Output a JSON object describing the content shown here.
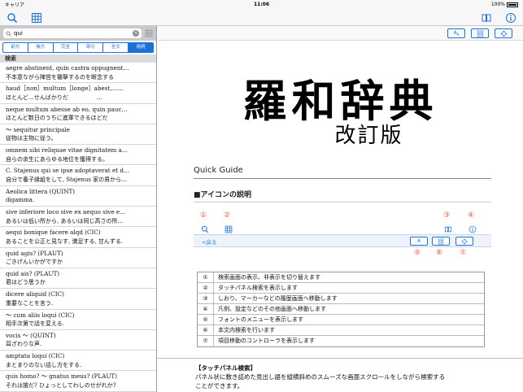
{
  "status": {
    "carrier": "キャリア",
    "time": "11:06",
    "battery": "100%"
  },
  "navbar": {
    "icons": [
      "search-icon",
      "grid-icon",
      "book-icon",
      "info-icon"
    ]
  },
  "search": {
    "query": "qui",
    "clear": "×"
  },
  "segments": [
    "前方",
    "後方",
    "完全",
    "部分",
    "全文",
    "用例"
  ],
  "section_header": "検索",
  "entries": [
    {
      "latin": "aegre abstinent, quin castra oppugnent…",
      "ja": "不本意ながら陣営を襲撃するのを断念する"
    },
    {
      "latin": "haud［non］multum［longe］abest,……",
      "ja": "ほとんど…せんばかりだ　　　　　…"
    },
    {
      "latin": "neque multum abesse ab eo, quin pauc…",
      "ja": "ほとんど数日のうちに進軍できるほどだ"
    },
    {
      "latin": "～ sequitur principale",
      "ja": "従物は主物に従う。"
    },
    {
      "latin": "omnem sibi reliquae vitae dignitatem a…",
      "ja": "自らの余生にあらゆる地位を獲得する。"
    },
    {
      "latin": "C. Stajenus qui se ipse adoptaverat et d…",
      "ja": "自分で養子縁組をして, Stajenus 家の男から…"
    },
    {
      "latin": "Aeolica littera (QUINT)",
      "ja": "digamma."
    },
    {
      "latin": "sive inferiore loco sive ex aequo sive e…",
      "ja": "あるいは低い所から, あるいは同じ高さの所…"
    },
    {
      "latin": "aequi bonique facere alqd (CIC)",
      "ja": "あることを公正と見なす, 満足する, 甘んずる."
    },
    {
      "latin": "quid agis? (PLAUT)",
      "ja": "ごきげんいかがですか"
    },
    {
      "latin": "quid ais? (PLAUT)",
      "ja": "君はどう思うか"
    },
    {
      "latin": "dicere aliquid (CIC)",
      "ja": "重要なことを言う."
    },
    {
      "latin": "～ cum aliis loqui (CIC)",
      "ja": "相手次第で話を変える."
    },
    {
      "latin": "vocis ～ (QUINT)",
      "ja": "耳ざわりな声."
    },
    {
      "latin": "amptata loqui (CIC)",
      "ja": "まとまりのない話し方をする."
    },
    {
      "latin": "quis homo? ～ gnatus meus? (PLAUT)",
      "ja": "それは誰だ? ひょっとしてわしのせがれか?"
    }
  ],
  "toolbar2": {
    "font_label": "A",
    "font_sub": "A"
  },
  "cover": {
    "title": "羅和辞典",
    "edition": "改訂版"
  },
  "guide": {
    "quick_guide": "Quick Guide",
    "icons_heading": "■アイコンの説明",
    "back_label": "<戻る",
    "numbers": [
      "①",
      "②",
      "③",
      "④",
      "⑤",
      "⑥",
      "⑦"
    ],
    "rows": [
      {
        "n": "①",
        "text": "検索画面の表示、非表示を切り替えます"
      },
      {
        "n": "②",
        "text": "タッチパネル検索を表示します"
      },
      {
        "n": "③",
        "text": "しおり、マーカーなどの履歴画面へ移動します"
      },
      {
        "n": "④",
        "text": "凡例、設定などのその他画面へ移動します"
      },
      {
        "n": "⑤",
        "text": "フォントのメニューを表示します"
      },
      {
        "n": "⑥",
        "text": "本文内検索を行います"
      },
      {
        "n": "⑦",
        "text": "項目移動のコントローラを表示します"
      }
    ],
    "panel_title": "【タッチパネル検索】",
    "panel_text_1": "パネル状に敷き詰めた見出し語を縦横斜めのスムーズな画面スクロールをしながら検索する",
    "panel_text_2": "ことができます。"
  }
}
